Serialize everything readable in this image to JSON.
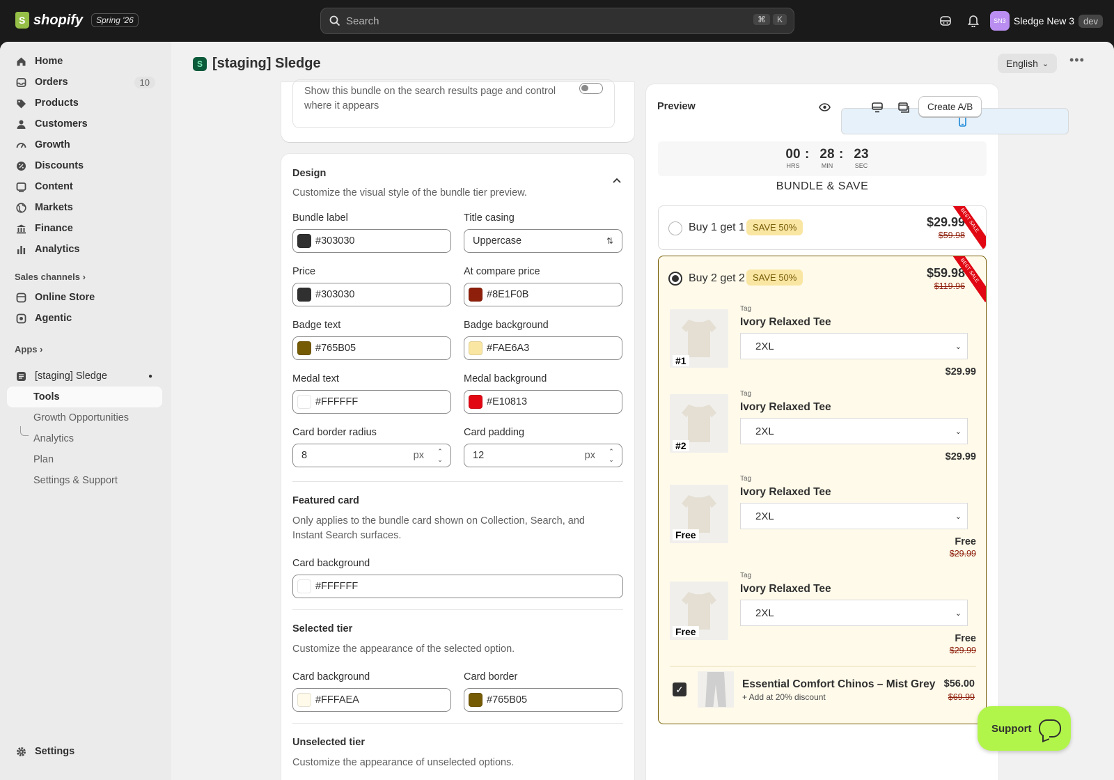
{
  "topbar": {
    "brand": "shopify",
    "edition": "Spring '26",
    "search_placeholder": "Search",
    "shortcut_cmd": "⌘",
    "shortcut_key": "K",
    "store_initials": "SN3",
    "store_name": "Sledge New 3",
    "store_badge": "dev"
  },
  "sidebar": {
    "items": [
      {
        "label": "Home",
        "icon": "home-icon"
      },
      {
        "label": "Orders",
        "icon": "orders-icon",
        "count": "10"
      },
      {
        "label": "Products",
        "icon": "tag-icon"
      },
      {
        "label": "Customers",
        "icon": "person-icon"
      },
      {
        "label": "Growth",
        "icon": "gauge-icon"
      },
      {
        "label": "Discounts",
        "icon": "discount-icon"
      },
      {
        "label": "Content",
        "icon": "content-icon"
      },
      {
        "label": "Markets",
        "icon": "globe-icon"
      },
      {
        "label": "Finance",
        "icon": "bank-icon"
      },
      {
        "label": "Analytics",
        "icon": "bar-chart-icon"
      }
    ],
    "sales_channels_heading": "Sales channels",
    "channels": [
      {
        "label": "Online Store",
        "icon": "store-icon"
      },
      {
        "label": "Agentic",
        "icon": "agentic-icon"
      }
    ],
    "apps_heading": "Apps",
    "app_name": "[staging] Sledge",
    "app_subitems": [
      "Tools",
      "Growth Opportunities",
      "Analytics",
      "Plan",
      "Settings & Support"
    ],
    "settings_label": "Settings"
  },
  "page": {
    "title": "[staging] Sledge",
    "language": "English"
  },
  "search_card": {
    "description": "Show this bundle on the search results page and control where it appears"
  },
  "design": {
    "title": "Design",
    "subtitle": "Customize the visual style of the bundle tier preview.",
    "fields": {
      "bundle_label": {
        "label": "Bundle label",
        "value": "#303030",
        "color": "#303030"
      },
      "title_casing": {
        "label": "Title casing",
        "value": "Uppercase"
      },
      "price": {
        "label": "Price",
        "value": "#303030",
        "color": "#303030"
      },
      "compare_price": {
        "label": "At compare price",
        "value": "#8E1F0B",
        "color": "#8E1F0B"
      },
      "badge_text": {
        "label": "Badge text",
        "value": "#765B05",
        "color": "#765B05"
      },
      "badge_bg": {
        "label": "Badge background",
        "value": "#FAE6A3",
        "color": "#FAE6A3"
      },
      "medal_text": {
        "label": "Medal text",
        "value": "#FFFFFF",
        "color": "#FFFFFF"
      },
      "medal_bg": {
        "label": "Medal background",
        "value": "#E10813",
        "color": "#E10813"
      },
      "radius": {
        "label": "Card border radius",
        "value": "8",
        "unit": "px"
      },
      "padding": {
        "label": "Card padding",
        "value": "12",
        "unit": "px"
      }
    },
    "featured": {
      "title": "Featured card",
      "subtitle": "Only applies to the bundle card shown on Collection, Search, and Instant Search surfaces.",
      "bg_label": "Card background",
      "bg_value": "#FFFFFF",
      "bg_color": "#FFFFFF"
    },
    "selected": {
      "title": "Selected tier",
      "subtitle": "Customize the appearance of the selected option.",
      "bg_label": "Card background",
      "bg_value": "#FFFAEA",
      "bg_color": "#FFFAEA",
      "border_label": "Card border",
      "border_value": "#765B05",
      "border_color": "#765B05"
    },
    "unselected": {
      "title": "Unselected tier",
      "subtitle": "Customize the appearance of unselected options."
    }
  },
  "preview": {
    "title": "Preview",
    "ab_button": "Create A/B",
    "timer": {
      "hrs": "00",
      "min": "28",
      "sec": "23",
      "hrs_label": "HRS",
      "min_label": "MIN",
      "sec_label": "SEC",
      "sep": ":"
    },
    "heading": "BUNDLE & SAVE",
    "ribbon": "BEST SALE",
    "tier1": {
      "name": "Buy 1 get 1",
      "badge": "SAVE 50%",
      "price": "$29.99",
      "compare": "$59.98"
    },
    "tier2": {
      "name": "Buy 2 get 2",
      "badge": "SAVE 50%",
      "price": "$59.98",
      "compare": "$119.96",
      "items": [
        {
          "tag": "Tag",
          "name": "Ivory Relaxed Tee",
          "size": "2XL",
          "marker": "#1",
          "price": "$29.99",
          "compare": ""
        },
        {
          "tag": "Tag",
          "name": "Ivory Relaxed Tee",
          "size": "2XL",
          "marker": "#2",
          "price": "$29.99",
          "compare": ""
        },
        {
          "tag": "Tag",
          "name": "Ivory Relaxed Tee",
          "size": "2XL",
          "marker": "Free",
          "price": "Free",
          "compare": "$29.99"
        },
        {
          "tag": "Tag",
          "name": "Ivory Relaxed Tee",
          "size": "2XL",
          "marker": "Free",
          "price": "Free",
          "compare": "$29.99"
        }
      ],
      "addon": {
        "name": "Essential Comfort Chinos – Mist Grey",
        "sub": "+ Add at 20% discount",
        "price": "$56.00",
        "compare": "$69.99"
      }
    }
  },
  "support_label": "Support"
}
